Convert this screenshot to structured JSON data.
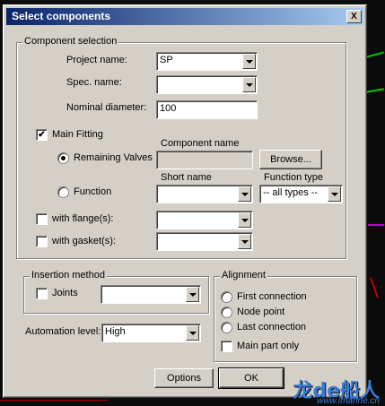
{
  "window": {
    "title": "Select components",
    "close_glyph": "X"
  },
  "component_selection": {
    "legend": "Component selection",
    "project_name": {
      "label": "Project name:",
      "value": "SP"
    },
    "spec_name": {
      "label": "Spec. name:",
      "value": ""
    },
    "nominal_diameter": {
      "label": "Nominal diameter:",
      "value": "100"
    },
    "main_fitting": {
      "label": "Main Fitting",
      "checked": true,
      "check_glyph": "✔"
    },
    "component_name_header": "Component name",
    "remaining_valves": {
      "label": "Remaining Valves",
      "selected": true
    },
    "browse_button": "Browse...",
    "short_name_header": "Short name",
    "function_type_header": "Function type",
    "function": {
      "label": "Function",
      "selected": false
    },
    "function_type_value": "-- all types --",
    "with_flanges": {
      "label": "with flange(s):",
      "checked": false
    },
    "with_gaskets": {
      "label": "with gasket(s):",
      "checked": false
    }
  },
  "insertion_method": {
    "legend": "Insertion method",
    "joints": {
      "label": "Joints",
      "checked": false
    }
  },
  "alignment": {
    "legend": "Alignment",
    "options": [
      {
        "label": "First connection",
        "selected": false
      },
      {
        "label": "Node point",
        "selected": false
      },
      {
        "label": "Last connection",
        "selected": false
      }
    ],
    "main_part_only": {
      "label": "Main part only",
      "checked": false
    }
  },
  "automation": {
    "label": "Automation level:",
    "value": "High"
  },
  "buttons": {
    "options": "Options",
    "ok": "OK"
  },
  "watermark": {
    "main": "龙de船人",
    "sub": "www.imarine.cn"
  },
  "colors": {
    "titlebar_start": "#0a246a",
    "titlebar_end": "#a6caf0",
    "dialog": "#d4d0c8"
  }
}
